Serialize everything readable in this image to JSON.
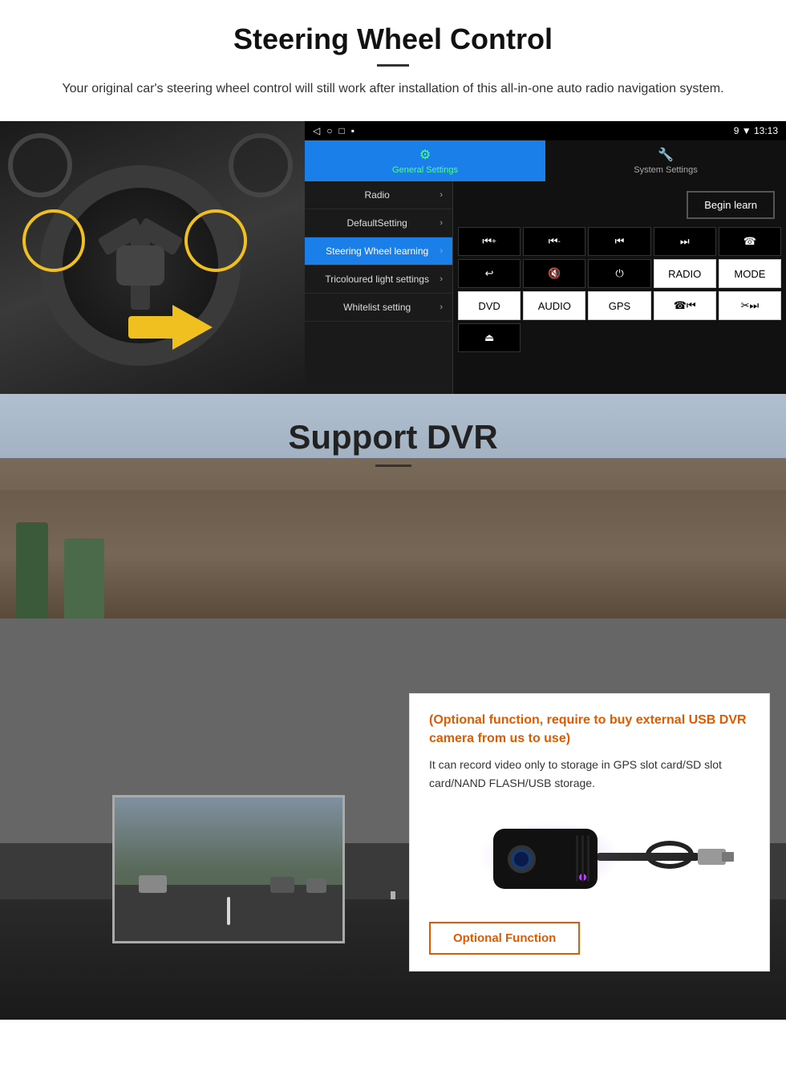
{
  "steering": {
    "title": "Steering Wheel Control",
    "subtitle": "Your original car's steering wheel control will still work after installation of this all-in-one auto radio navigation system.",
    "statusbar": {
      "icons": "◁  ○  □  ▪",
      "time": "13:13",
      "signal": "▼"
    },
    "tabs": [
      {
        "id": "general",
        "icon": "⚙",
        "label": "General Settings",
        "active": true
      },
      {
        "id": "system",
        "icon": "🔧",
        "label": "System Settings",
        "active": false
      }
    ],
    "menu": [
      {
        "id": "radio",
        "label": "Radio",
        "active": false
      },
      {
        "id": "default",
        "label": "DefaultSetting",
        "active": false
      },
      {
        "id": "steering",
        "label": "Steering Wheel learning",
        "active": true
      },
      {
        "id": "tricoloured",
        "label": "Tricoloured light settings",
        "active": false
      },
      {
        "id": "whitelist",
        "label": "Whitelist setting",
        "active": false
      }
    ],
    "begin_learn": "Begin learn",
    "controls": {
      "row1": [
        "⏮+",
        "⏮-",
        "⏮",
        "⏭",
        "☎"
      ],
      "row2": [
        "↩",
        "🔇",
        "⏻",
        "RADIO",
        "MODE"
      ],
      "row3": [
        "DVD",
        "AUDIO",
        "GPS",
        "☎⏮",
        "✂⏭"
      ],
      "row4": [
        "⏏"
      ]
    }
  },
  "dvr": {
    "title": "Support DVR",
    "info_title": "(Optional function, require to buy external USB DVR camera from us to use)",
    "info_text": "It can record video only to storage in GPS slot card/SD slot card/NAND FLASH/USB storage.",
    "optional_button": "Optional Function"
  }
}
